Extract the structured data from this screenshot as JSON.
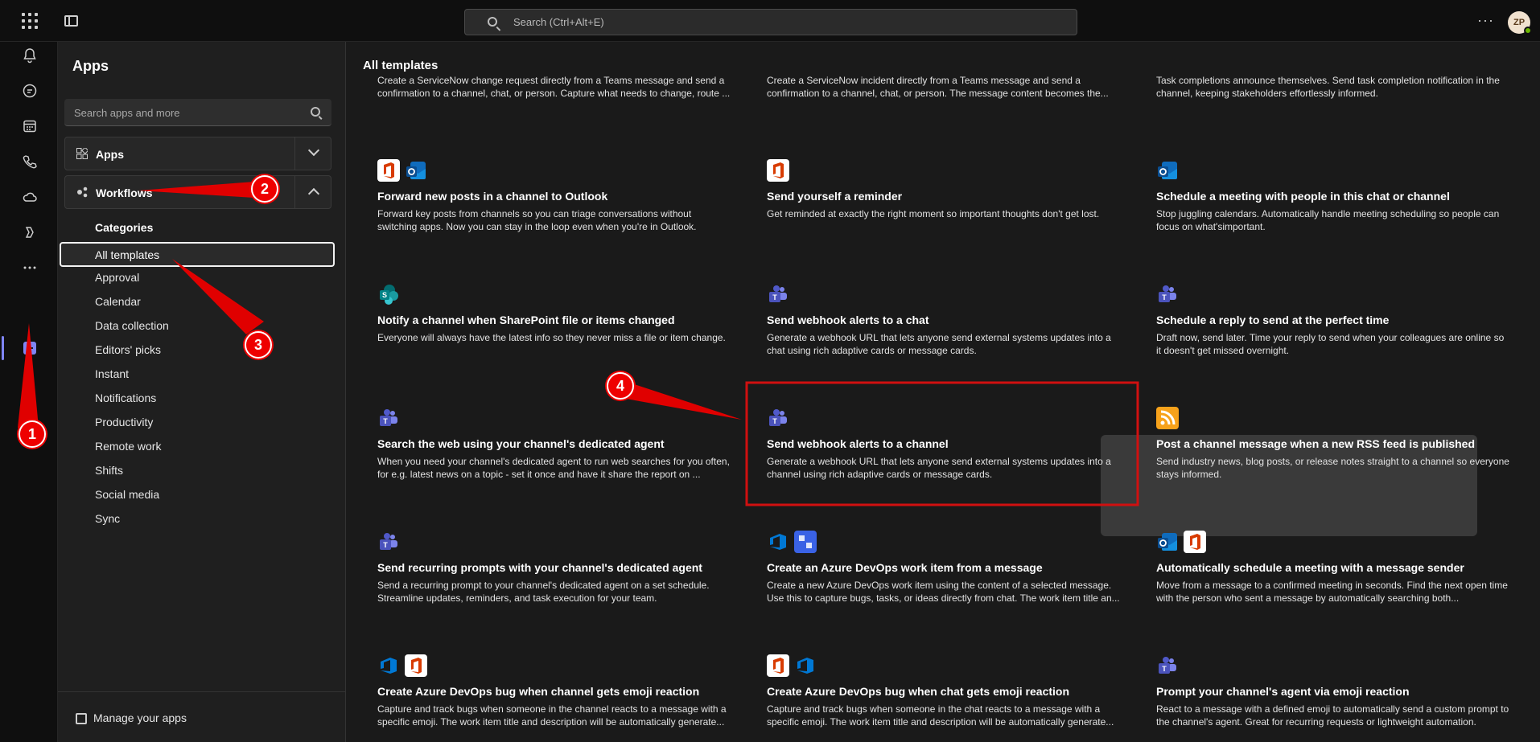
{
  "topbar": {
    "search_placeholder": "Search (Ctrl+Alt+E)",
    "more_label": "···",
    "avatar_initials": "ZP"
  },
  "sidebar": {
    "title": "Apps",
    "search_placeholder": "Search apps and more",
    "apps_label": "Apps",
    "workflows_label": "Workflows",
    "categories_heading": "Categories",
    "selected_category": "All templates",
    "categories": [
      "Approval",
      "Calendar",
      "Data collection",
      "Editors' picks",
      "Instant",
      "Notifications",
      "Productivity",
      "Remote work",
      "Shifts",
      "Social media",
      "Sync"
    ],
    "manage_label": "Manage your apps"
  },
  "main": {
    "title": "All templates",
    "top_row": [
      {
        "desc": "Create a ServiceNow change request directly from a Teams message and send a confirmation to a channel, chat, or person. Capture what needs to change, route ..."
      },
      {
        "desc": "Create a ServiceNow incident directly from a Teams message and send a confirmation to a channel, chat, or person. The message content becomes the..."
      },
      {
        "desc": "Task completions announce themselves. Send task completion notification in the channel, keeping stakeholders effortlessly informed."
      }
    ],
    "cards": [
      {
        "title": "Forward new posts in a channel to Outlook",
        "desc": "Forward key posts from channels so you can triage conversations without switching apps. Now you can stay in the loop even when you're in Outlook.",
        "icons": [
          "office",
          "outlook"
        ]
      },
      {
        "title": "Send yourself a reminder",
        "desc": "Get reminded at exactly the right moment so important thoughts don't get lost.",
        "icons": [
          "office"
        ]
      },
      {
        "title": "Schedule a meeting with people in this chat or channel",
        "desc": "Stop juggling calendars. Automatically handle meeting scheduling so people can focus on what'simportant.",
        "icons": [
          "outlook"
        ]
      },
      {
        "title": "Notify a channel when SharePoint file or items changed",
        "desc": "Everyone will always have the latest info so they never miss a file or item change.",
        "icons": [
          "sharepoint"
        ]
      },
      {
        "title": "Send webhook alerts to a chat",
        "desc": "Generate a webhook URL that lets anyone send external systems updates into a chat using rich adaptive cards or message cards.",
        "icons": [
          "teams"
        ]
      },
      {
        "title": "Schedule a reply to send at the perfect time",
        "desc": "Draft now, send later. Time your reply to send when your colleagues are online so it doesn't get missed overnight.",
        "icons": [
          "teams"
        ]
      },
      {
        "title": "Search the web using your channel's dedicated agent",
        "desc": "When you need your channel's dedicated agent to run web searches for you often, for e.g. latest news on a topic - set it once and have it share the report on ...",
        "icons": [
          "teams"
        ]
      },
      {
        "title": "Send webhook alerts to a channel",
        "desc": "Generate a webhook URL that lets anyone send external systems updates into a channel using rich adaptive cards or message cards.",
        "icons": [
          "teams"
        ]
      },
      {
        "title": "Post a channel message when a new RSS feed is published",
        "desc": "Send industry news, blog posts, or release notes straight to a channel so everyone stays informed.",
        "icons": [
          "rss"
        ]
      },
      {
        "title": "Send recurring prompts with your channel's dedicated agent",
        "desc": "Send a recurring prompt to your channel's dedicated agent on a set schedule. Streamline updates, reminders, and task execution for your team.",
        "icons": [
          "teams"
        ]
      },
      {
        "title": "Create an Azure DevOps work item from a message",
        "desc": "Create a new Azure DevOps work item using the content of a selected message. Use this to capture bugs, tasks, or ideas directly from chat. The work item title an...",
        "icons": [
          "devops",
          "devops2"
        ]
      },
      {
        "title": "Automatically schedule a meeting with a message sender",
        "desc": "Move from a message to a confirmed meeting in seconds. Find the next open time with the person who sent a message by automatically searching both...",
        "icons": [
          "outlook",
          "office"
        ]
      },
      {
        "title": "Create Azure DevOps bug when channel gets emoji reaction",
        "desc": "Capture and track bugs when someone in the channel reacts to a message with a specific emoji. The work item title and description will be automatically generate...",
        "icons": [
          "devops",
          "office"
        ]
      },
      {
        "title": "Create Azure DevOps bug when chat gets emoji reaction",
        "desc": "Capture and track bugs when someone in the chat reacts to a message with a specific emoji. The work item title and description will be automatically generate...",
        "icons": [
          "office",
          "devops"
        ]
      },
      {
        "title": "Prompt your channel's agent via emoji reaction",
        "desc": "React to a message with a defined emoji to automatically send a custom prompt to the channel's agent. Great for recurring requests or lightweight automation.",
        "icons": [
          "teams"
        ]
      }
    ]
  },
  "annotations": {
    "badges": [
      "1",
      "2",
      "3",
      "4"
    ],
    "arrow_color": "#e00000",
    "highlight_color": "#d01010"
  }
}
